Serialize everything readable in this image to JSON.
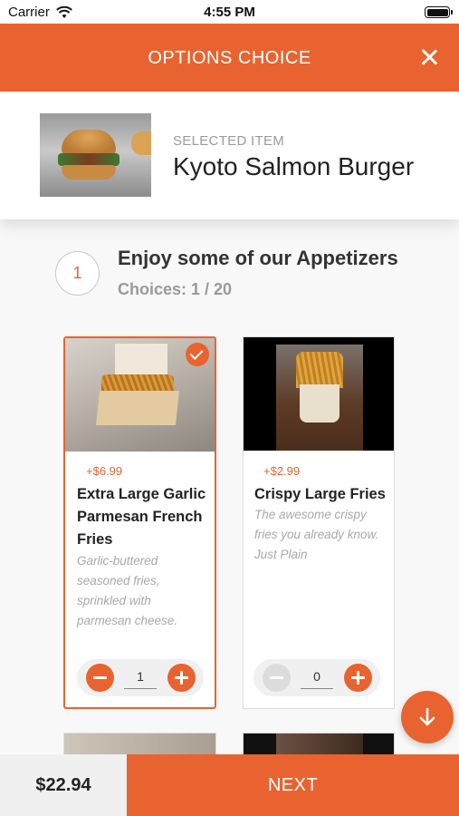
{
  "status_bar": {
    "carrier": "Carrier",
    "time": "4:55 PM"
  },
  "header": {
    "title": "OPTIONS CHOICE"
  },
  "selected_item": {
    "label": "SELECTED ITEM",
    "name": "Kyoto Salmon Burger"
  },
  "group": {
    "step_number": "1",
    "title": "Enjoy some of our Appetizers",
    "choices": "Choices: 1 / 20"
  },
  "cards": [
    {
      "price": "+$6.99",
      "name": "Extra Large Garlic Parmesan French Fries",
      "description": "Garlic-buttered seasoned fries, sprinkled with parmesan cheese.",
      "quantity": "1",
      "selected": true
    },
    {
      "price": "+$2.99",
      "name": "Crispy Large Fries",
      "description": "The awesome crispy fries you already know. Just Plain",
      "quantity": "0",
      "selected": false
    }
  ],
  "footer": {
    "total": "$22.94",
    "next_label": "NEXT"
  },
  "colors": {
    "accent": "#e8632f",
    "disabled": "#dcdcdc"
  },
  "icons": [
    "wifi-icon",
    "battery-icon",
    "close-icon",
    "checkmark-icon",
    "minus-icon",
    "plus-icon",
    "arrow-down-icon"
  ]
}
